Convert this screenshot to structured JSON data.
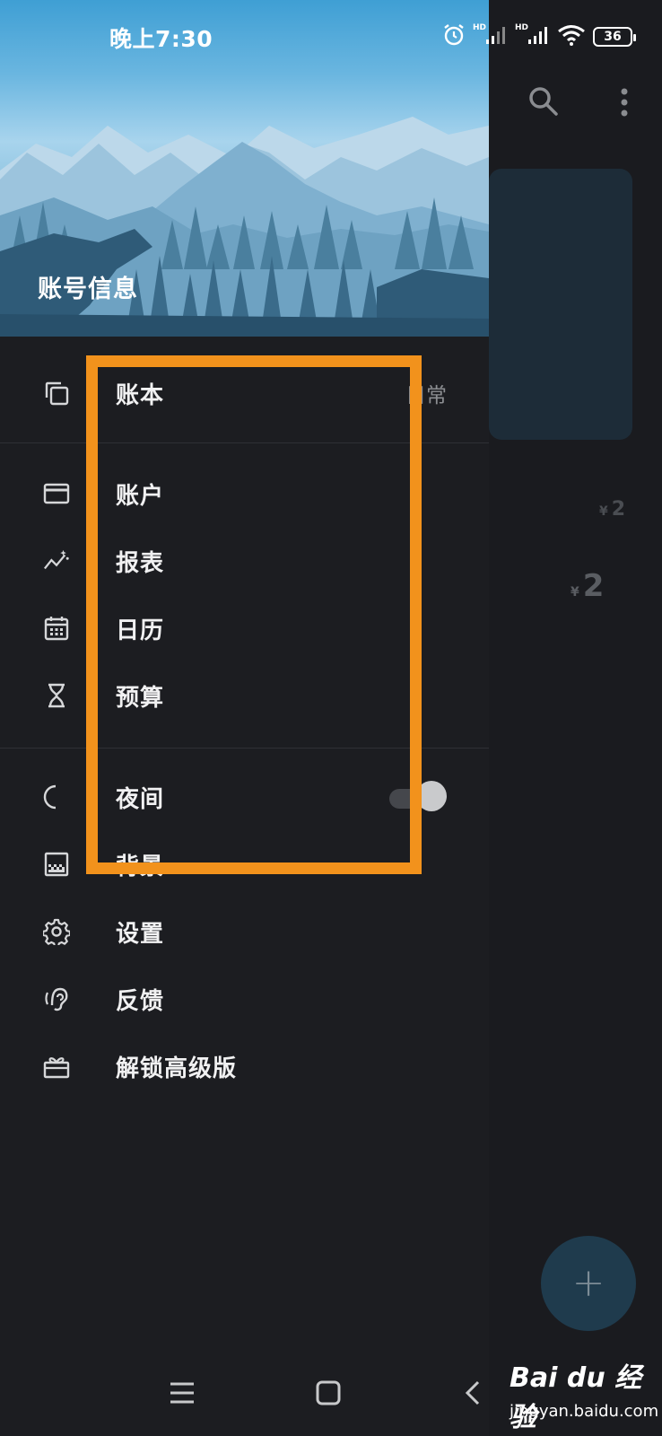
{
  "status_bar": {
    "time": "晚上7:30",
    "hd1": "HD",
    "hd2": "HD",
    "battery": "36"
  },
  "drawer": {
    "header_title": "账号信息",
    "items": [
      {
        "label": "账本",
        "suffix": "日常",
        "icon": "copy-icon"
      },
      {
        "label": "账户",
        "icon": "card-icon"
      },
      {
        "label": "报表",
        "icon": "trend-icon"
      },
      {
        "label": "日历",
        "icon": "calendar-icon"
      },
      {
        "label": "预算",
        "icon": "hourglass-icon"
      },
      {
        "label": "夜间",
        "icon": "moon-icon",
        "toggle": "off"
      },
      {
        "label": "背景",
        "icon": "background-icon"
      },
      {
        "label": "设置",
        "icon": "gear-icon"
      },
      {
        "label": "反馈",
        "icon": "feedback-icon"
      },
      {
        "label": "解锁高级版",
        "icon": "gift-icon"
      }
    ]
  },
  "background_app": {
    "amount_small": "2",
    "amount_large": "2",
    "currency": "¥",
    "fab_label": "+",
    "icons": [
      "search-icon",
      "more-icon"
    ]
  },
  "watermark": {
    "brand": "Bai du 经验",
    "url": "jingyan.baidu.com"
  },
  "colors": {
    "highlight": "#f2921c",
    "drawer_bg": "#1c1d21",
    "fab": "#1f3b4d"
  }
}
